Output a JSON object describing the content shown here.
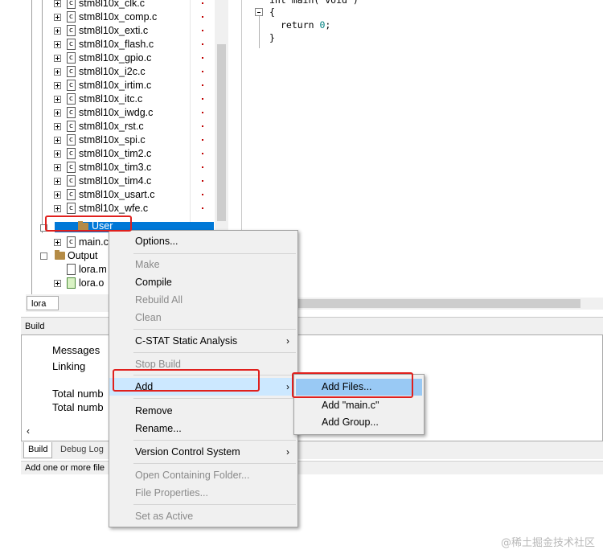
{
  "workspace": {
    "files": [
      "stm8l10x_clk.c",
      "stm8l10x_comp.c",
      "stm8l10x_exti.c",
      "stm8l10x_flash.c",
      "stm8l10x_gpio.c",
      "stm8l10x_i2c.c",
      "stm8l10x_irtim.c",
      "stm8l10x_itc.c",
      "stm8l10x_iwdg.c",
      "stm8l10x_rst.c",
      "stm8l10x_spi.c",
      "stm8l10x_tim2.c",
      "stm8l10x_tim3.c",
      "stm8l10x_tim4.c",
      "stm8l10x_usart.c",
      "stm8l10x_wfe.c"
    ],
    "user_group": "User",
    "user_file": "main.c",
    "output_group": "Output",
    "output_files": [
      "lora.m",
      "lora.o"
    ],
    "tab_label": "lora"
  },
  "editor": {
    "line1": "int main( void )",
    "line2": "{",
    "line3_kw": "return",
    "line3_num": "0",
    "line3_end": ";",
    "line4": "}"
  },
  "build": {
    "title": "Build",
    "rows": [
      "Messages",
      "Linking",
      "Total numb",
      "Total numb"
    ],
    "tabs": [
      "Build",
      "Debug Log"
    ],
    "status_text": "Add one or more file"
  },
  "context_menu": {
    "items": [
      {
        "label": "Options...",
        "disabled": false
      },
      {
        "label": "Make",
        "disabled": true
      },
      {
        "label": "Compile",
        "disabled": false
      },
      {
        "label": "Rebuild All",
        "disabled": true
      },
      {
        "label": "Clean",
        "disabled": true
      },
      {
        "label": "C-STAT Static Analysis",
        "disabled": false
      },
      {
        "label": "Stop Build",
        "disabled": true
      },
      {
        "label": "Add",
        "disabled": false
      },
      {
        "label": "Remove",
        "disabled": false
      },
      {
        "label": "Rename...",
        "disabled": false
      },
      {
        "label": "Version Control System",
        "disabled": false
      },
      {
        "label": "Open Containing Folder...",
        "disabled": true
      },
      {
        "label": "File Properties...",
        "disabled": true
      },
      {
        "label": "Set as Active",
        "disabled": true
      }
    ],
    "submenu_arrow": "›"
  },
  "add_submenu": {
    "items": [
      "Add Files...",
      "Add \"main.c\"",
      "Add Group..."
    ]
  },
  "watermark": "@稀土掘金技术社区",
  "colors": {
    "selection": "#0078d7",
    "menu_highlight": "#cce8ff",
    "submenu_highlight": "#99c9f4",
    "annotation_red": "#e0201d"
  }
}
